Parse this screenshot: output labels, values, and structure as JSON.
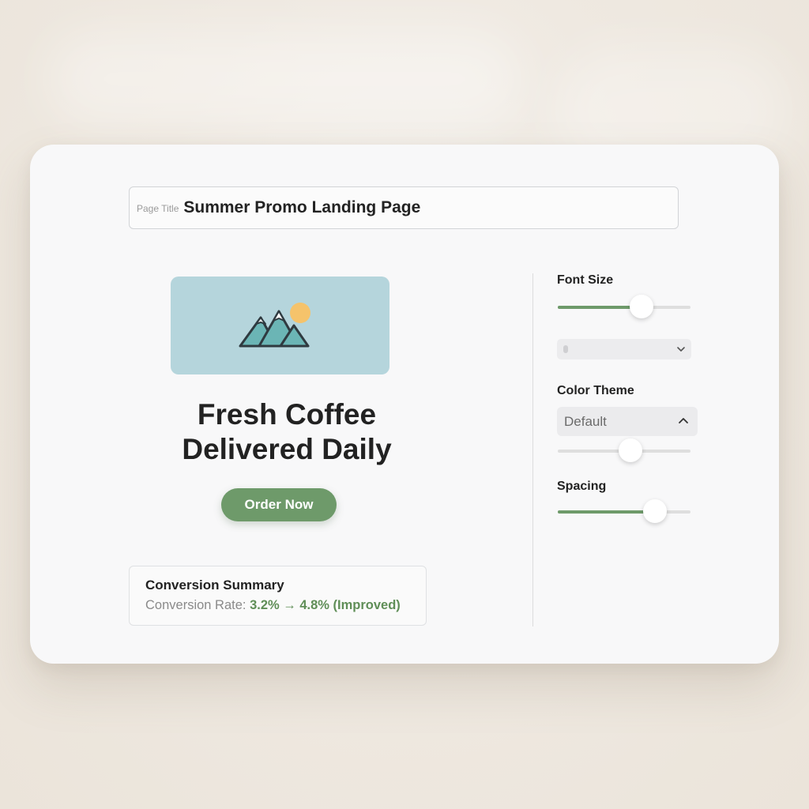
{
  "page_title_field": {
    "label": "Page Title",
    "value": "Summer Promo Landing Page"
  },
  "preview": {
    "image_icon": "mountain-sun-icon",
    "headline_line1": "Fresh Coffee",
    "headline_line2": "Delivered Daily",
    "cta_label": "Order Now"
  },
  "summary": {
    "title": "Conversion Summary",
    "rate_label": "Conversion Rate:",
    "rate_value": "3.2% → 4.8% (Improved)"
  },
  "settings": {
    "font_size": {
      "label": "Font Size",
      "level": 0.63
    },
    "font_dropdown": {
      "value": "",
      "icon": "chevron-down-icon"
    },
    "color_theme": {
      "label": "Color Theme",
      "value": "Default",
      "icon": "chevron-up-icon",
      "slider_level": 0.55
    },
    "spacing": {
      "label": "Spacing",
      "level": 0.73
    }
  },
  "colors": {
    "accent_green": "#6e9a6a",
    "image_bg": "#b5d5dc",
    "sun": "#f5c36b",
    "mountain": "#6bb5b5"
  }
}
